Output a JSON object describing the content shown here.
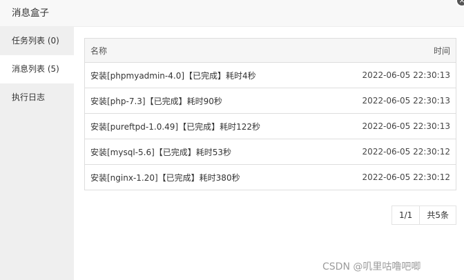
{
  "dialog": {
    "title": "消息盒子",
    "close_glyph": "×"
  },
  "sidebar": {
    "items": [
      {
        "label": "任务列表 (0)"
      },
      {
        "label": "消息列表 (5)"
      },
      {
        "label": "执行日志"
      }
    ],
    "active_index": 1
  },
  "table": {
    "headers": {
      "name": "名称",
      "time": "时间"
    },
    "rows": [
      {
        "name": "安装[phpmyadmin-4.0]【已完成】耗时4秒",
        "time": "2022-06-05 22:30:13"
      },
      {
        "name": "安装[php-7.3]【已完成】耗时90秒",
        "time": "2022-06-05 22:30:13"
      },
      {
        "name": "安装[pureftpd-1.0.49]【已完成】耗时122秒",
        "time": "2022-06-05 22:30:13"
      },
      {
        "name": "安装[mysql-5.6]【已完成】耗时53秒",
        "time": "2022-06-05 22:30:12"
      },
      {
        "name": "安装[nginx-1.20]【已完成】耗时380秒",
        "time": "2022-06-05 22:30:12"
      }
    ]
  },
  "pagination": {
    "current": "1/1",
    "total": "共5条"
  },
  "watermark": "CSDN @叽里咕噜吧唧"
}
